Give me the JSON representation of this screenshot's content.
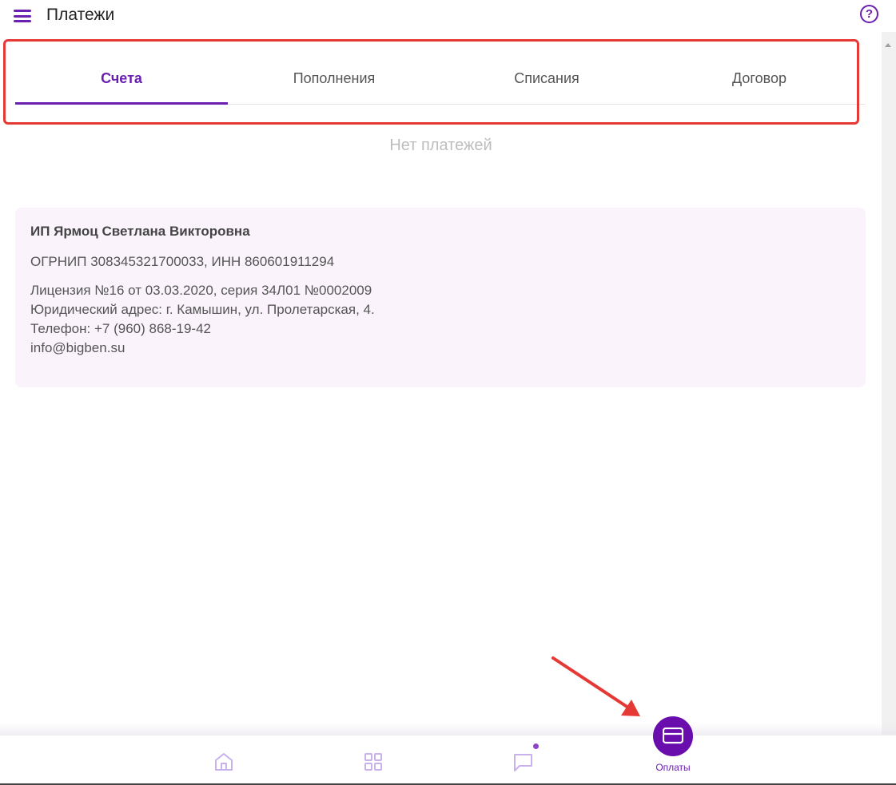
{
  "header": {
    "title": "Платежи",
    "menu_icon": "menu-icon",
    "help_icon": "help-icon",
    "help_glyph": "?"
  },
  "tabs": [
    {
      "label": "Счета",
      "active": true
    },
    {
      "label": "Пополнения",
      "active": false
    },
    {
      "label": "Списания",
      "active": false
    },
    {
      "label": "Договор",
      "active": false
    }
  ],
  "empty_state": "Нет платежей",
  "company": {
    "name": "ИП Ярмоц Светлана Викторовна",
    "ids": "ОГРНИП 308345321700033, ИНН 860601911294",
    "license": "Лицензия №16 от 03.03.2020, серия 34Л01 №0002009",
    "address": "Юридический адрес: г. Камышин, ул. Пролетарская, 4.",
    "phone": "Телефон: +7 (960) 868-19-42",
    "email": "info@bigben.su"
  },
  "bottom_nav": {
    "items": [
      {
        "icon": "home-icon"
      },
      {
        "icon": "grid-icon"
      },
      {
        "icon": "chat-icon",
        "has_notification": true
      },
      {
        "icon": "card-icon",
        "label": "Оплаты",
        "active": true
      }
    ]
  },
  "colors": {
    "accent": "#6a1fb0",
    "annotation": "#e53935"
  }
}
